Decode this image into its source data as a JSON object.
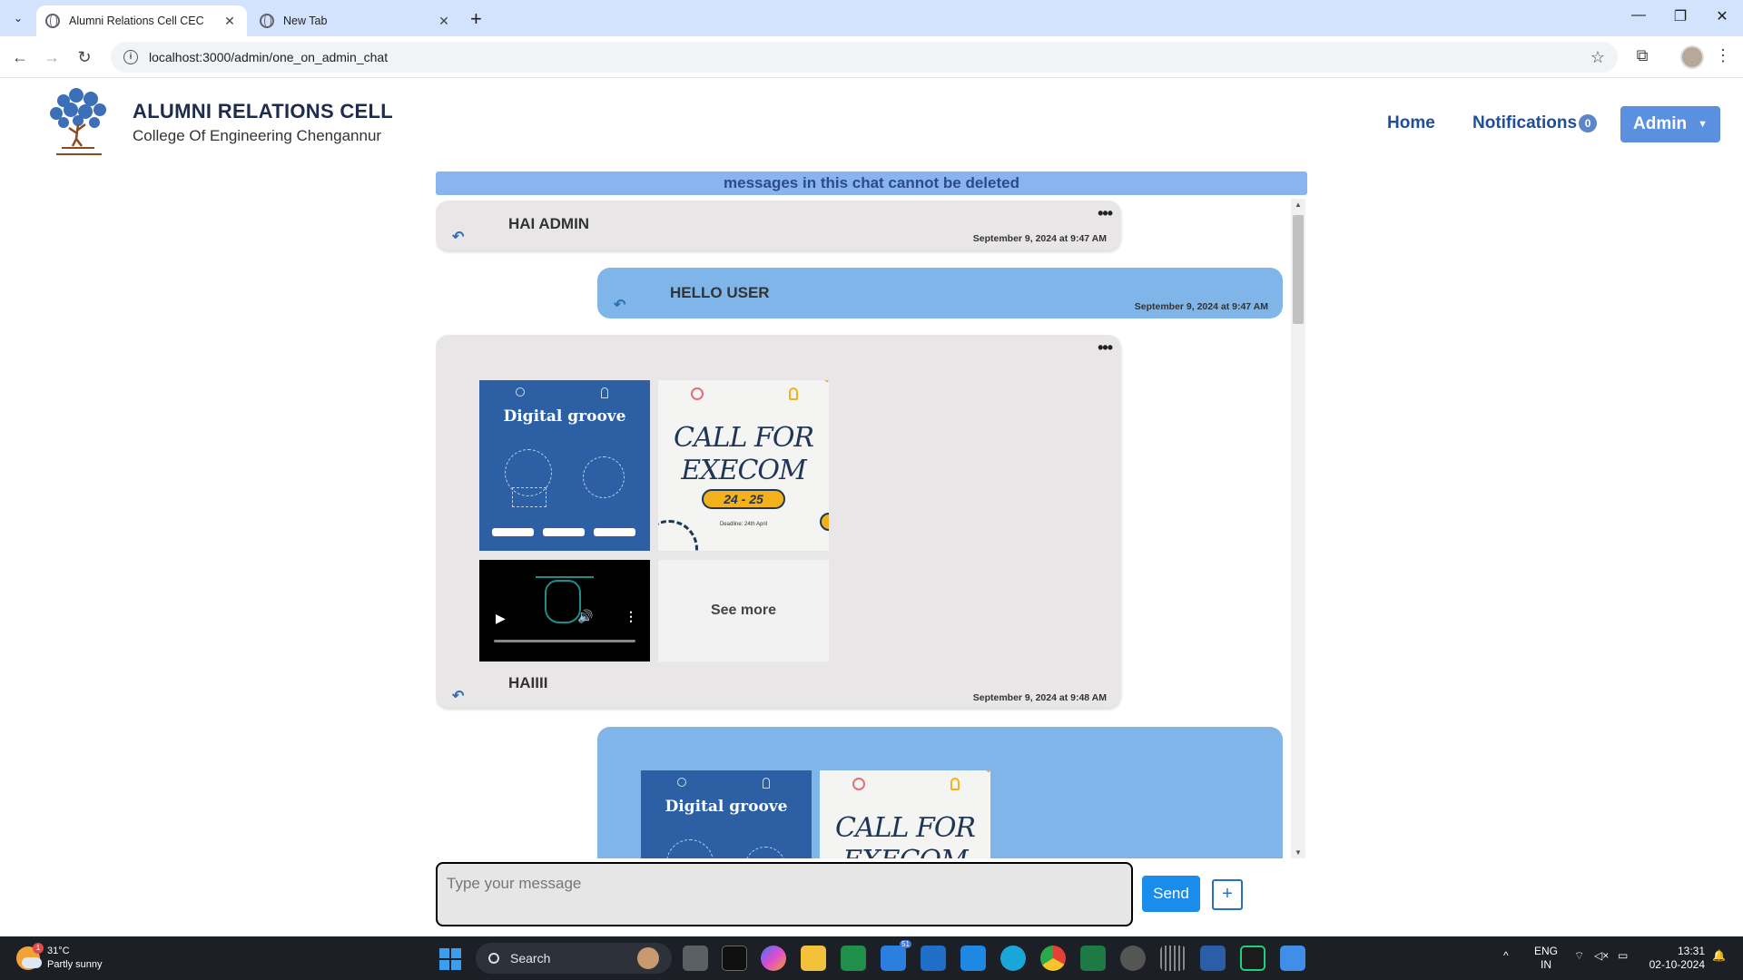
{
  "browser": {
    "tabs": [
      {
        "title": "Alumni Relations Cell CEC",
        "active": true
      },
      {
        "title": "New Tab",
        "active": false
      }
    ],
    "url": "localhost:3000/admin/one_on_admin_chat"
  },
  "header": {
    "title": "ALUMNI RELATIONS CELL",
    "subtitle": "College Of Engineering Chengannur",
    "nav": {
      "home": "Home",
      "notifications": "Notifications",
      "notification_count": "0",
      "admin": "Admin"
    }
  },
  "chat": {
    "notice": "messages in this chat cannot be deleted",
    "messages": [
      {
        "direction": "incoming",
        "text": "HAI ADMIN",
        "time": "September 9, 2024 at 9:47 AM"
      },
      {
        "direction": "outgoing",
        "text": "HELLO USER",
        "time": "September 9, 2024 at 9:47 AM"
      },
      {
        "direction": "incoming",
        "text": "HAIIII",
        "time": "September 9, 2024 at 9:48 AM",
        "attachments": {
          "poster1_title": "Digital groove",
          "poster2_title": "CALL FOR EXECOM",
          "poster2_year": "24 - 25",
          "poster2_deadline": "Deadline: 24th April",
          "see_more": "See more"
        }
      },
      {
        "direction": "outgoing",
        "attachments": {
          "poster1_title": "Digital groove",
          "poster2_title": "CALL FOR EXECOM"
        }
      }
    ]
  },
  "composer": {
    "placeholder": "Type your message",
    "send_label": "Send",
    "plus_label": "+"
  },
  "taskbar": {
    "weather_temp": "31°C",
    "weather_desc": "Partly sunny",
    "weather_badge": "1",
    "search_label": "Search",
    "mail_badge": "51",
    "lang_line1": "ENG",
    "lang_line2": "IN",
    "time": "13:31",
    "date": "02-10-2024"
  },
  "colors": {
    "accent": "#5b8fe0",
    "incoming_bubble": "#e8e6e6",
    "outgoing_bubble": "#7fb5e8",
    "notice_bg": "#8ab4f0"
  }
}
